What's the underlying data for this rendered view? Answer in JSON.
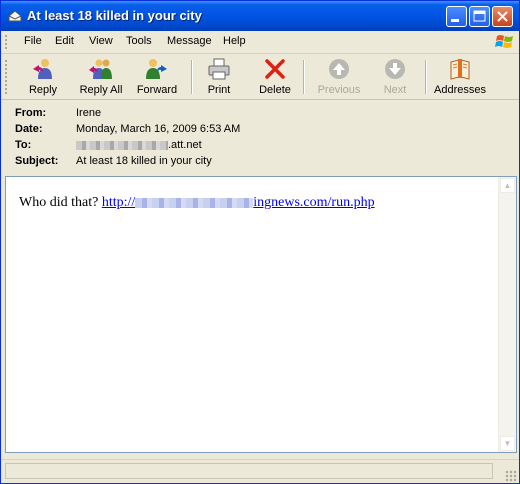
{
  "window": {
    "title": "At least 18 killed in your city"
  },
  "menu": [
    "File",
    "Edit",
    "View",
    "Tools",
    "Message",
    "Help"
  ],
  "toolbar": {
    "reply": "Reply",
    "reply_all": "Reply All",
    "forward": "Forward",
    "print": "Print",
    "delete": "Delete",
    "previous": "Previous",
    "next": "Next",
    "addresses": "Addresses"
  },
  "header": {
    "from_label": "From:",
    "from_value": "Irene",
    "date_label": "Date:",
    "date_value": "Monday, March 16, 2009 6:53 AM",
    "to_label": "To:",
    "to_value": ".att.net",
    "subject_label": "Subject:",
    "subject_value": "At least 18 killed in your city"
  },
  "message": {
    "text": "Who did that?",
    "link_prefix": "http://",
    "link_suffix": "ingnews.com/run.php"
  }
}
